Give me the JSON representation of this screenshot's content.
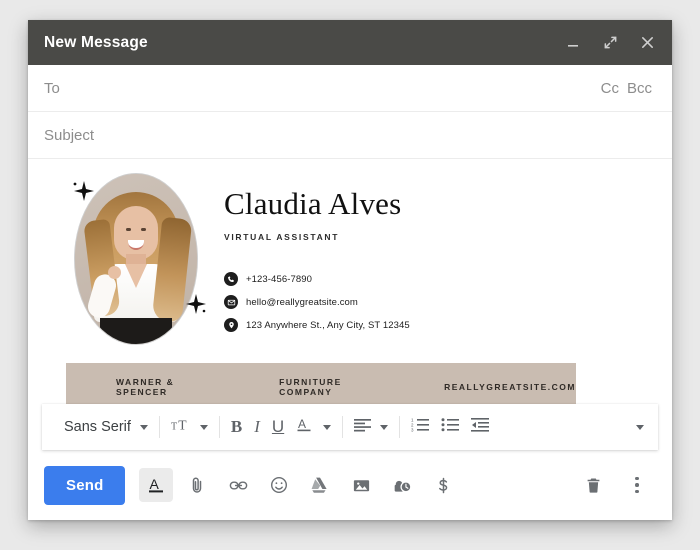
{
  "window": {
    "title": "New Message",
    "controls": [
      {
        "name": "minimize",
        "icon": "minimize-icon"
      },
      {
        "name": "expand",
        "icon": "expand-icon"
      },
      {
        "name": "close",
        "icon": "close-icon"
      }
    ]
  },
  "fields": {
    "to_placeholder": "To",
    "to_value": "",
    "subject_placeholder": "Subject",
    "subject_value": "",
    "cc_label": "Cc",
    "bcc_label": "Bcc"
  },
  "signature": {
    "name": "Claudia Alves",
    "role": "VIRTUAL ASSISTANT",
    "photo_alt": "portrait-photo",
    "contacts": [
      {
        "icon": "phone-icon",
        "text": "+123-456-7890"
      },
      {
        "icon": "envelope-icon",
        "text": "hello@reallygreatsite.com"
      },
      {
        "icon": "location-pin-icon",
        "text": "123 Anywhere St., Any City, ST 12345"
      }
    ],
    "banner": {
      "background": "#c9bcb1",
      "items": [
        "WARNER & SPENCER",
        "FURNITURE COMPANY",
        "REALLYGREATSITE.COM"
      ]
    }
  },
  "format_toolbar": {
    "font_family": "Sans Serif",
    "items": [
      {
        "name": "font-family",
        "label": "Sans Serif"
      },
      {
        "name": "font-size",
        "label": ""
      },
      {
        "name": "bold",
        "label": "B"
      },
      {
        "name": "italic",
        "label": "I"
      },
      {
        "name": "underline",
        "label": "U"
      },
      {
        "name": "text-color",
        "label": "A"
      },
      {
        "name": "align",
        "label": ""
      },
      {
        "name": "numbered-list",
        "label": ""
      },
      {
        "name": "bulleted-list",
        "label": ""
      },
      {
        "name": "indent-less",
        "label": ""
      },
      {
        "name": "more-options",
        "label": ""
      }
    ]
  },
  "action_bar": {
    "send_label": "Send",
    "icons": [
      {
        "name": "formatting-options-icon",
        "active": true
      },
      {
        "name": "attach-file-icon",
        "active": false
      },
      {
        "name": "insert-link-icon",
        "active": false
      },
      {
        "name": "insert-emoji-icon",
        "active": false
      },
      {
        "name": "google-drive-icon",
        "active": false
      },
      {
        "name": "insert-photo-icon",
        "active": false
      },
      {
        "name": "confidential-mode-icon",
        "active": false
      },
      {
        "name": "insert-money-icon",
        "active": false
      }
    ],
    "right_icons": [
      {
        "name": "discard-draft-icon"
      },
      {
        "name": "more-options-icon"
      }
    ]
  },
  "colors": {
    "header_bg": "#4a4a47",
    "send_blue": "#3b7ded",
    "banner_beige": "#c9bcb1",
    "page_bg": "#e9e9e9"
  }
}
